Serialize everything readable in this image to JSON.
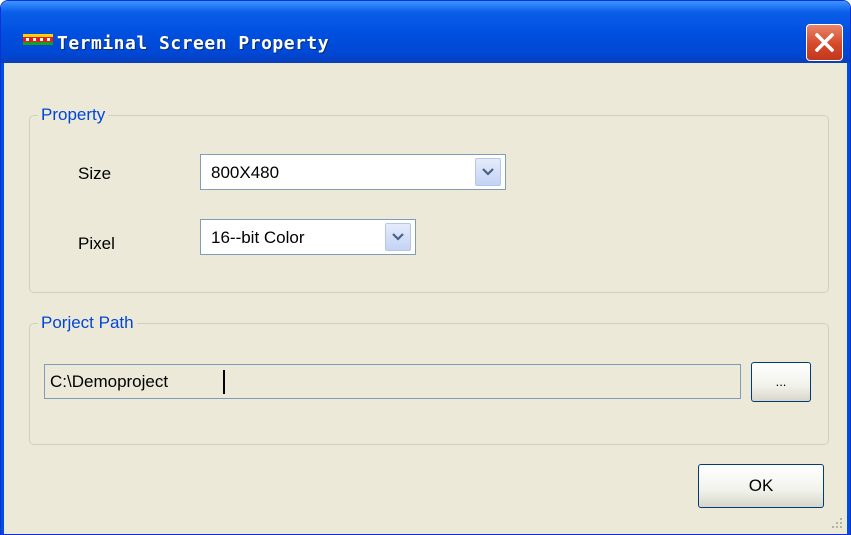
{
  "window": {
    "title": "Terminal Screen Property"
  },
  "property_group": {
    "legend": "Property",
    "size": {
      "label": "Size",
      "value": "800X480"
    },
    "pixel": {
      "label": "Pixel",
      "value": "16--bit Color"
    }
  },
  "path_group": {
    "legend": "Porject Path",
    "path_value": "C:\\Demoproject",
    "browse_label": "..."
  },
  "footer": {
    "ok_label": "OK"
  },
  "colors": {
    "titlebar": "#0050e0",
    "legend_text": "#0046d5",
    "dialog_bg": "#ece9d8",
    "close_button": "#d6482a"
  }
}
